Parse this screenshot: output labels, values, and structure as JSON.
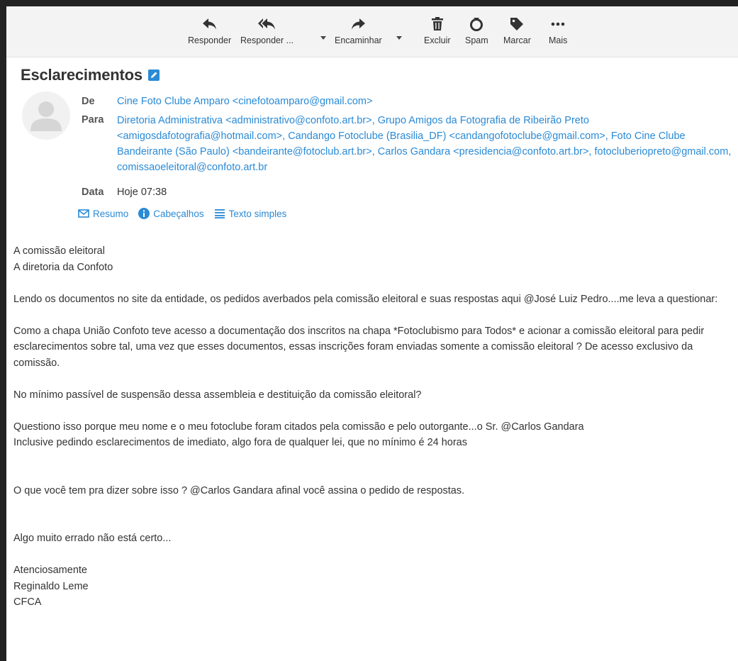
{
  "toolbar": {
    "reply": "Responder",
    "reply_all": "Responder ...",
    "forward": "Encaminhar",
    "delete": "Excluir",
    "spam": "Spam",
    "mark": "Marcar",
    "more": "Mais"
  },
  "message": {
    "subject": "Esclarecimentos",
    "from_label": "De",
    "from": "Cine Foto Clube Amparo <cinefotoamparo@gmail.com>",
    "to_label": "Para",
    "to": "Diretoria Administrativa <administrativo@confoto.art.br>, Grupo Amigos da Fotografia de Ribeirão Preto <amigosdafotografia@hotmail.com>, Candango Fotoclube (Brasilia_DF) <candangofotoclube@gmail.com>, Foto Cine Clube Bandeirante (São Paulo) <bandeirante@fotoclub.art.br>, Carlos Gandara <presidencia@confoto.art.br>, fotocluberiopreto@gmail.com, comissaoeleitoral@confoto.art.br",
    "date_label": "Data",
    "date": "Hoje 07:38",
    "view_summary": "Resumo",
    "view_headers": "Cabeçalhos",
    "view_plain": "Texto simples"
  },
  "body": {
    "l1": "A comissão eleitoral",
    "l2": "A diretoria da Confoto",
    "p1": "Lendo os documentos no site da entidade, os pedidos averbados pela comissão eleitoral e suas respostas aqui @José Luiz Pedro....me leva a questionar:",
    "p2": "Como a chapa União Confoto teve acesso a documentação dos inscritos na chapa *Fotoclubismo para Todos* e acionar a comissão eleitoral para pedir esclarecimentos sobre tal, uma vez que esses documentos, essas inscrições foram enviadas somente a comissão eleitoral ? De acesso exclusivo da comissão.",
    "p3": "No mínimo passível de suspensão dessa assembleia e destituição da comissão eleitoral?",
    "p4a": "Questiono isso porque meu nome e o meu fotoclube foram citados pela comissão e pelo outorgante...o Sr. @Carlos Gandara",
    "p4b": "Inclusive pedindo esclarecimentos de imediato, algo fora de qualquer lei, que no mínimo é 24 horas",
    "p5": "O que você tem pra dizer sobre isso ? @Carlos Gandara afinal você assina o pedido de respostas.",
    "p6": "Algo muito errado não está certo...",
    "s1": "Atenciosamente",
    "s2": "Reginaldo Leme",
    "s3": "CFCA"
  }
}
